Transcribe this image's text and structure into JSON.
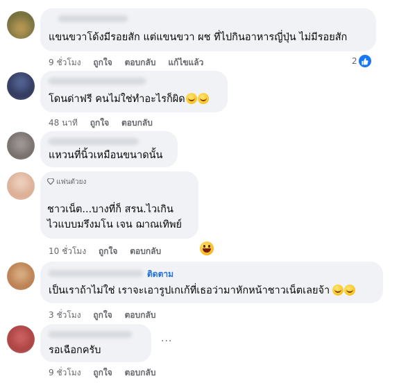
{
  "comments": [
    {
      "text_lines": [
        "แขนขวาโด้งมีรอยสัก แต่แขนขวา ผช ที่ไปกินอาหารญี่ปุ่น ไม่มีรอยสัก"
      ],
      "time": "9 ชั่วโมง",
      "actions": [
        "ถูกใจ",
        "ตอบกลับ",
        "แก้ไขแล้ว"
      ],
      "reaction_count": "2",
      "reaction_icon": "like-icon"
    },
    {
      "text_lines": [
        "โดนด่าฟรี คนไม่ใช่ทำอะไรก็ผิด"
      ],
      "emoji": [
        "laughing-tears-icon",
        "laughing-tears-icon"
      ],
      "time": "48 นาที",
      "actions": [
        "ถูกใจ",
        "ตอบกลับ"
      ]
    },
    {
      "text_lines": [
        "แหวนที่นิ้วเหมือนขนาดนั้น"
      ]
    },
    {
      "badge": "แฟนตัวยง",
      "badge_icon": "diamond-icon",
      "text_lines": [
        "ชาวเน็ต...บางที่ก็ สรน.ไวเกิน",
        "ไวแบบมรึงมโน เจน ฌาณเทิพย์"
      ],
      "time": "10 ชั่วโมง",
      "actions": [
        "ถูกใจ",
        "ตอบกลับ"
      ],
      "reaction_icon": "laughing-icon"
    },
    {
      "follow_label": "ติดตาม",
      "text_lines": [
        "เป็นเราถ้าไม่ใช่ เราจะเอารูปเกเก้ที่เธอว่ามาหักหน้าชาวเน็ตเลยจ้า"
      ],
      "emoji": [
        "smirk-icon",
        "grin-icon"
      ],
      "time": "3 ชั่วโมง",
      "actions": [
        "ถูกใจ",
        "ตอบกลับ"
      ]
    },
    {
      "text_lines": [
        "รอเฉือกครับ"
      ],
      "more_label": "···",
      "time": "9 ชั่วโมง",
      "actions": [
        "ถูกใจ",
        "ตอบกลับ"
      ]
    }
  ],
  "colors": {
    "bubble": "#f0f2f5",
    "meta_text": "#65676b",
    "link_blue": "#216fdb",
    "like_blue": "#1877f2"
  }
}
